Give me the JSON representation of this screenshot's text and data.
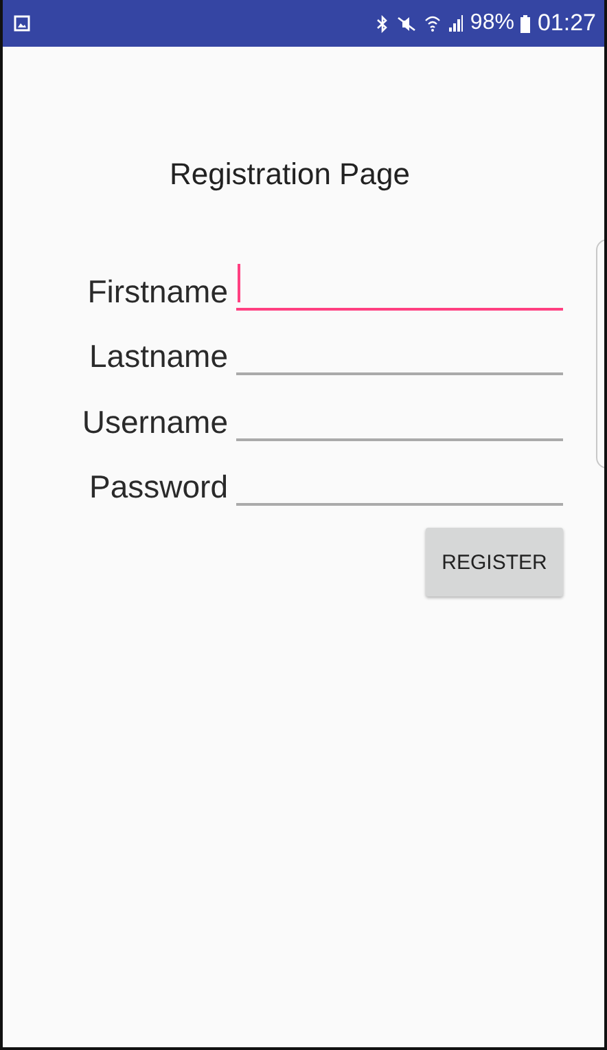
{
  "status_bar": {
    "battery": "98%",
    "time": "01:27"
  },
  "title": "Registration Page",
  "fields": [
    {
      "label": "Firstname",
      "focused": true
    },
    {
      "label": "Lastname",
      "focused": false
    },
    {
      "label": "Username",
      "focused": false
    },
    {
      "label": "Password",
      "focused": false
    }
  ],
  "button": "REGISTER"
}
